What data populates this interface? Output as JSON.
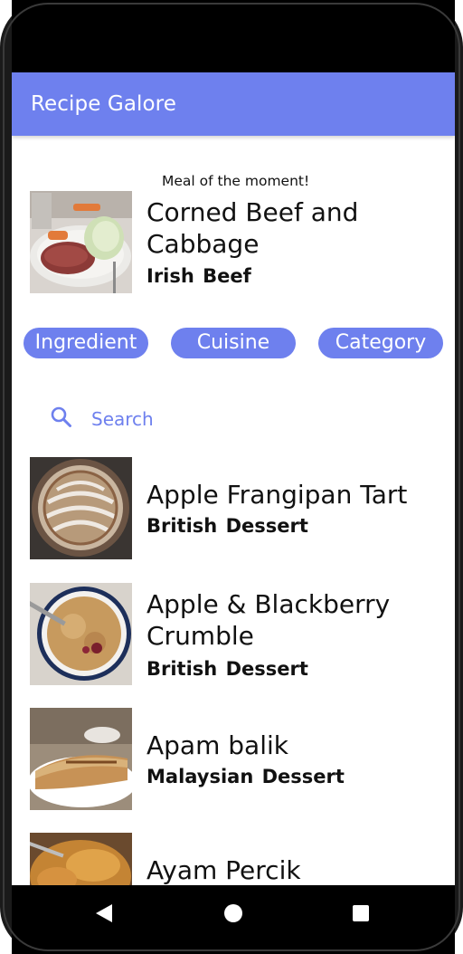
{
  "app_bar": {
    "title": "Recipe Galore"
  },
  "featured": {
    "label": "Meal of the moment!",
    "name": "Corned Beef and Cabbage",
    "area": "Irish",
    "category": "Beef",
    "image_icon": "corned-beef-photo"
  },
  "filters": [
    {
      "label": "Ingredient"
    },
    {
      "label": "Cuisine"
    },
    {
      "label": "Category"
    }
  ],
  "search": {
    "placeholder": "Search",
    "value": ""
  },
  "recipes": [
    {
      "name": "Apple Frangipan Tart",
      "area": "British",
      "category": "Dessert"
    },
    {
      "name": "Apple & Blackberry Crumble",
      "area": "British",
      "category": "Dessert"
    },
    {
      "name": "Apam balik",
      "area": "Malaysian",
      "category": "Dessert"
    },
    {
      "name": "Ayam Percik",
      "area": "",
      "category": ""
    }
  ],
  "colors": {
    "accent": "#6e80ee",
    "text": "#111111",
    "background": "#ffffff"
  },
  "nav": {
    "back_icon": "back-triangle-icon",
    "home_icon": "home-circle-icon",
    "recents_icon": "recents-square-icon"
  }
}
